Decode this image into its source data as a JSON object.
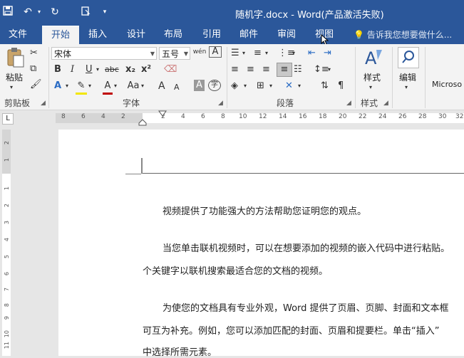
{
  "window": {
    "title": "随机字.docx - Word(产品激活失败)"
  },
  "quick_access": {
    "save_icon": "save-icon",
    "undo_icon": "undo-icon",
    "redo_icon": "redo-icon",
    "touch_icon": "touch-mode-icon",
    "more_icon": "customize-icon"
  },
  "tabs": [
    {
      "label": "文件"
    },
    {
      "label": "开始"
    },
    {
      "label": "插入"
    },
    {
      "label": "设计"
    },
    {
      "label": "布局"
    },
    {
      "label": "引用"
    },
    {
      "label": "邮件"
    },
    {
      "label": "审阅"
    },
    {
      "label": "视图"
    }
  ],
  "tell_me": "告诉我您想要做什么...",
  "ribbon": {
    "paste_label": "粘贴",
    "font_name": "宋体",
    "font_size": "五号",
    "style_label": "样式",
    "edit_label": "编辑",
    "more_label": "Microso",
    "groups": {
      "clipboard": "剪贴板",
      "font": "字体",
      "paragraph": "段落",
      "styles": "样式"
    },
    "buttons": {
      "bold": "B",
      "italic": "I",
      "underline": "U",
      "strike": "abc",
      "sub": "x₂",
      "sup": "x²",
      "grow": "A",
      "shrink": "A",
      "case": "Aa",
      "wen": "wén",
      "clear": "A"
    }
  },
  "ruler": {
    "h_ticks": [
      "8",
      "6",
      "4",
      "2",
      "2",
      "4",
      "6",
      "8",
      "10",
      "12",
      "14",
      "16",
      "18",
      "20",
      "22",
      "24",
      "26",
      "28",
      "30",
      "32"
    ],
    "v_ticks": [
      "2",
      "1",
      "1",
      "2",
      "3",
      "4",
      "5",
      "6",
      "7",
      "8",
      "9",
      "10",
      "11"
    ]
  },
  "document": {
    "paragraphs": [
      "视频提供了功能强大的方法帮助您证明您的观点。",
      "当您单击联机视频时，可以在想要添加的视频的嵌入代码中进行粘贴。",
      "个关键字以联机搜索最适合您的文档的视频。",
      "为使您的文档具有专业外观，Word 提供了页眉、页脚、封面和文本框",
      "可互为补充。例如，您可以添加匹配的封面、页眉和提要栏。单击“插入”",
      "中选择所需元素。"
    ]
  }
}
